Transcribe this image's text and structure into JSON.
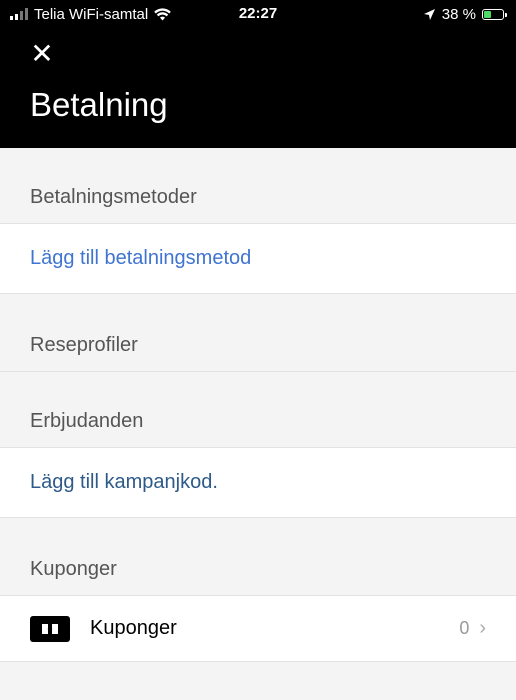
{
  "status_bar": {
    "carrier": "Telia WiFi-samtal",
    "time": "22:27",
    "battery": "38 %"
  },
  "header": {
    "close_glyph": "✕",
    "title": "Betalning"
  },
  "sections": {
    "payment_methods": {
      "header": "Betalningsmetoder",
      "action": "Lägg till betalningsmetod"
    },
    "travel_profiles": {
      "header": "Reseprofiler"
    },
    "offers": {
      "header": "Erbjudanden",
      "action": "Lägg till kampanjkod."
    },
    "coupons": {
      "header": "Kuponger",
      "item_label": "Kuponger",
      "count": "0"
    }
  },
  "colors": {
    "link_blue": "#3f74d1",
    "link_dark": "#2e5a8a",
    "header_bg": "#000000",
    "page_bg": "#f4f4f4"
  }
}
